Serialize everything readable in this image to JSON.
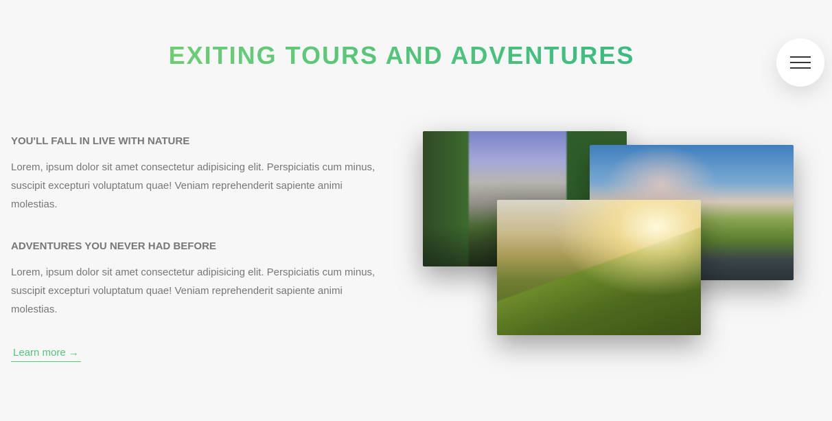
{
  "section": {
    "title": "EXITING TOURS AND ADVENTURES"
  },
  "navigation": {
    "menu_icon": "hamburger-menu-icon"
  },
  "content": {
    "heading_1": "YOU'LL FALL IN LIVE WITH NATURE",
    "paragraph_1": "Lorem, ipsum dolor sit amet consectetur adipisicing elit. Perspiciatis cum minus, suscipit excepturi voluptatum quae! Veniam reprehenderit sapiente animi molestias.",
    "heading_2": "ADVENTURES YOU NEVER HAD BEFORE",
    "paragraph_2": "Lorem, ipsum dolor sit amet consectetur adipisicing elit. Perspiciatis cum minus, suscipit excepturi voluptatum quae! Veniam reprehenderit sapiente animi molestias.",
    "link_label": "Learn more →"
  },
  "colors": {
    "gradient_start": "#7ed56f",
    "gradient_end": "#28b485",
    "link": "#55c57a",
    "text": "#777777",
    "background": "#f7f7f7"
  }
}
